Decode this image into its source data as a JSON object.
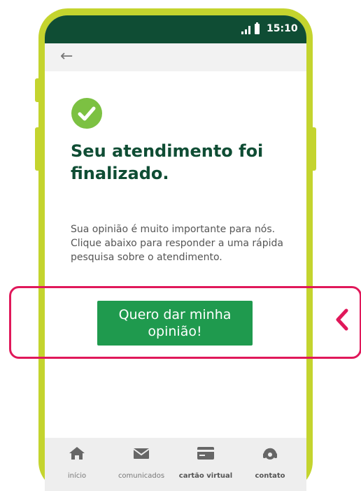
{
  "status_bar": {
    "time": "15:10",
    "icons": [
      "signal-icon",
      "battery-icon"
    ]
  },
  "app_bar": {
    "back_icon": "arrow-left-icon"
  },
  "main": {
    "success_icon": "check-circle-icon",
    "title": "Seu atendimento foi finalizado.",
    "description": "Sua opinião é muito importante para nós. Clique abaixo para responder a uma rápida pesquisa sobre o atendimento.",
    "cta_label": "Quero dar minha opinião!"
  },
  "bottom_nav": {
    "items": [
      {
        "label": "início",
        "icon": "home-icon"
      },
      {
        "label": "comunicados",
        "icon": "mail-icon"
      },
      {
        "label": "cartão virtual",
        "icon": "card-icon"
      },
      {
        "label": "contato",
        "icon": "headset-icon"
      }
    ]
  },
  "colors": {
    "phone_frame": "#c4d42e",
    "status_bar": "#0f4d34",
    "title": "#0f4d34",
    "check": "#7cc142",
    "cta": "#1f9a4e",
    "highlight": "#e0185a"
  }
}
